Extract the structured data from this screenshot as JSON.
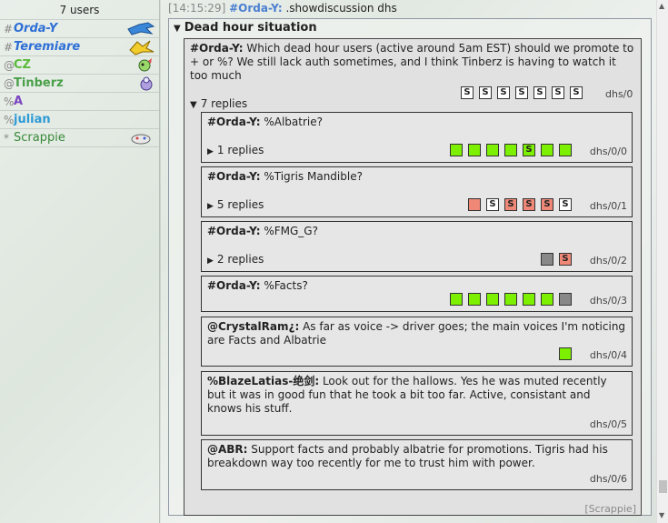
{
  "userlist": {
    "count": "7 users",
    "users": [
      {
        "group": "#",
        "name": "Orda-Y",
        "color": "#2e6fd6",
        "italic": true,
        "avatar": "bird-blue"
      },
      {
        "group": "#",
        "name": "Teremiare",
        "color": "#2e6fd6",
        "italic": true,
        "avatar": "bird-yellow"
      },
      {
        "group": "@",
        "name": "CZ",
        "color": "#5aba3c",
        "italic": false,
        "avatar": "creature-green"
      },
      {
        "group": "@",
        "name": "Tinberz",
        "color": "#4aa04a",
        "italic": false,
        "avatar": "creature-purple"
      },
      {
        "group": "%",
        "name": "A",
        "color": "#7b44c0",
        "italic": false,
        "avatar": ""
      },
      {
        "group": "%",
        "name": "julian",
        "color": "#2e9ad6",
        "italic": false,
        "avatar": ""
      },
      {
        "group": "*",
        "name": "Scrappie",
        "color": "#3a8a3a",
        "italic": false,
        "avatar": "bot"
      }
    ]
  },
  "chat": {
    "timestamp": "[14:15:29]",
    "command_user": "#Orda-Y:",
    "command_text": " .showdiscussion dhs",
    "box_title": "Dead hour situation",
    "post": {
      "author": "#Orda-Y:",
      "text": " Which dead hour users (active around 5am EST) should we promote to + or %? We still lack auth sometimes, and I think Tinberz is having to watch it too much",
      "votes": [
        "S",
        "S",
        "S",
        "S",
        "S",
        "S",
        "S"
      ],
      "path": "dhs/0",
      "replies_label": "7 replies"
    },
    "replies": [
      {
        "author": "#Orda-Y:",
        "text": " %Albatrie?",
        "votes": [
          "g",
          "g",
          "g",
          "g",
          "gS",
          "g",
          "g"
        ],
        "path": "dhs/0/0",
        "sub": "1 replies"
      },
      {
        "author": "#Orda-Y:",
        "text": " %Tigris Mandible?",
        "votes": [
          "r",
          "S",
          "rS",
          "rS",
          "rS",
          "S"
        ],
        "path": "dhs/0/1",
        "sub": "5 replies"
      },
      {
        "author": "#Orda-Y:",
        "text": " %FMG_G?",
        "votes": [
          "x",
          "rS"
        ],
        "path": "dhs/0/2",
        "sub": "2 replies"
      },
      {
        "author": "#Orda-Y:",
        "text": " %Facts?",
        "votes": [
          "g",
          "g",
          "g",
          "g",
          "g",
          "g",
          "x"
        ],
        "path": "dhs/0/3",
        "sub": ""
      },
      {
        "author": "@CrystalRam¿:",
        "text": " As far as voice -> driver goes; the main voices I'm noticing are Facts and Albatrie",
        "votes": [
          "g"
        ],
        "path": "dhs/0/4",
        "sub": ""
      },
      {
        "author": "%BlazeLatias-绝剑:",
        "text": " Look out for the hallows. Yes he was muted recently but it was in good fun that he took a bit too far. Active, consistant and knows his stuff.",
        "votes": [],
        "path": "dhs/0/5",
        "sub": ""
      },
      {
        "author": "@ABR:",
        "text": " Support facts and probably albatrie for promotions. Tigris had his breakdown way too recently for me to trust him with power.",
        "votes": [],
        "path": "dhs/0/6",
        "sub": ""
      }
    ],
    "footer_tag": "[Scrappie]"
  }
}
